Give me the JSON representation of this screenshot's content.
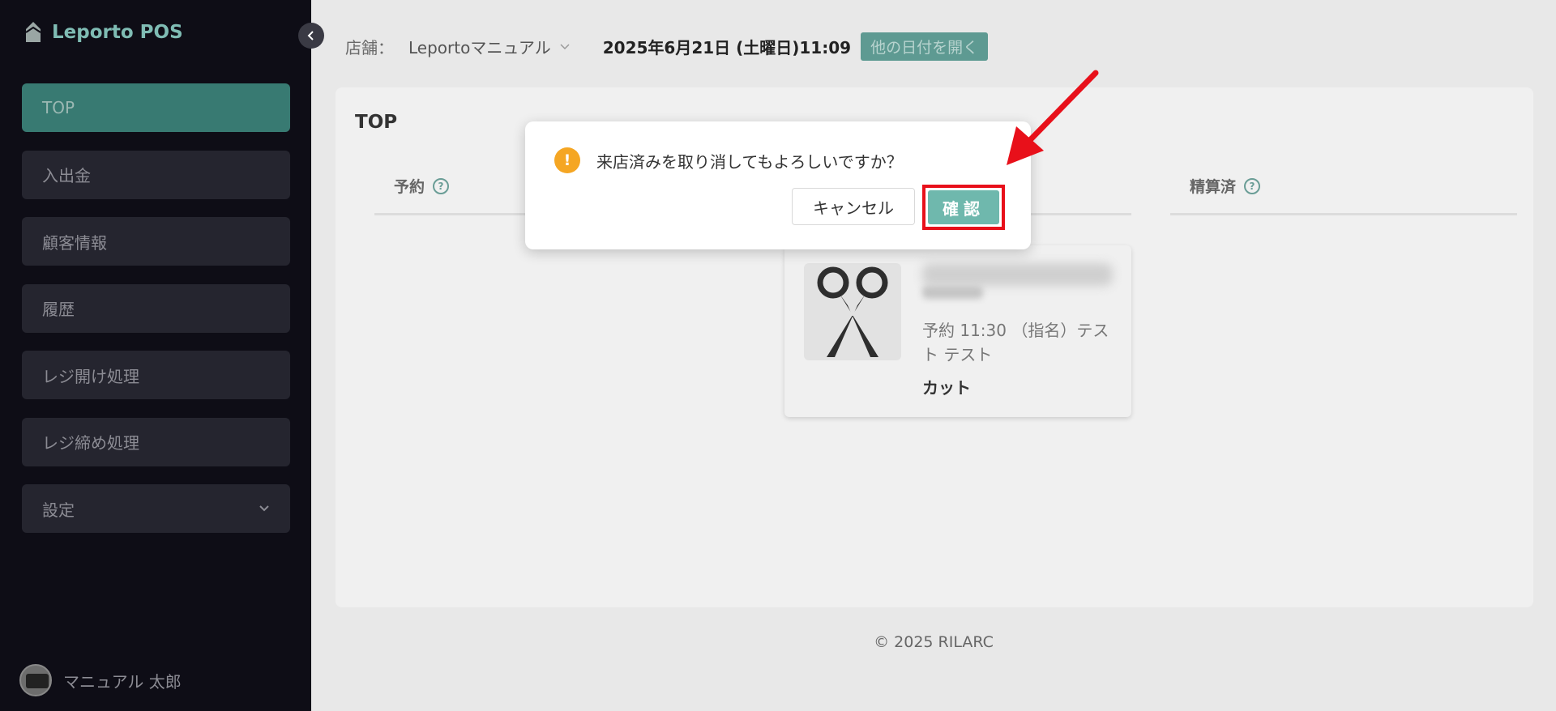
{
  "sidebar": {
    "brand_name": "Leporto POS",
    "menu": [
      {
        "label": "TOP",
        "active": true
      },
      {
        "label": "入出金"
      },
      {
        "label": "顧客情報"
      },
      {
        "label": "履歴"
      },
      {
        "label": "レジ開け処理"
      },
      {
        "label": "レジ締め処理"
      },
      {
        "label": "設定"
      }
    ],
    "user_name": "マニュアル 太郎"
  },
  "header": {
    "store_label": "店舗：",
    "store_name": "Leportoマニュアル",
    "date": "2025年6月21日 (土曜日)11:09",
    "other_date_button": "他の日付を開く"
  },
  "main": {
    "title": "TOP",
    "columns": [
      {
        "label": "予約"
      },
      {
        "label": "精算済"
      }
    ],
    "reservation": {
      "info": "予約 11:30 （指名）テスト テスト",
      "service": "カット"
    }
  },
  "dialog": {
    "message": "来店済みを取り消してもよろしいですか？",
    "cancel_label": "キャンセル",
    "confirm_label": "確認"
  },
  "footer": {
    "copyright": "© 2025 RILARC"
  },
  "colors": {
    "accent": "#6fb8ad",
    "sidebar_bg": "#0e0d16",
    "highlight": "#e8101a",
    "warning": "#f5a623"
  }
}
